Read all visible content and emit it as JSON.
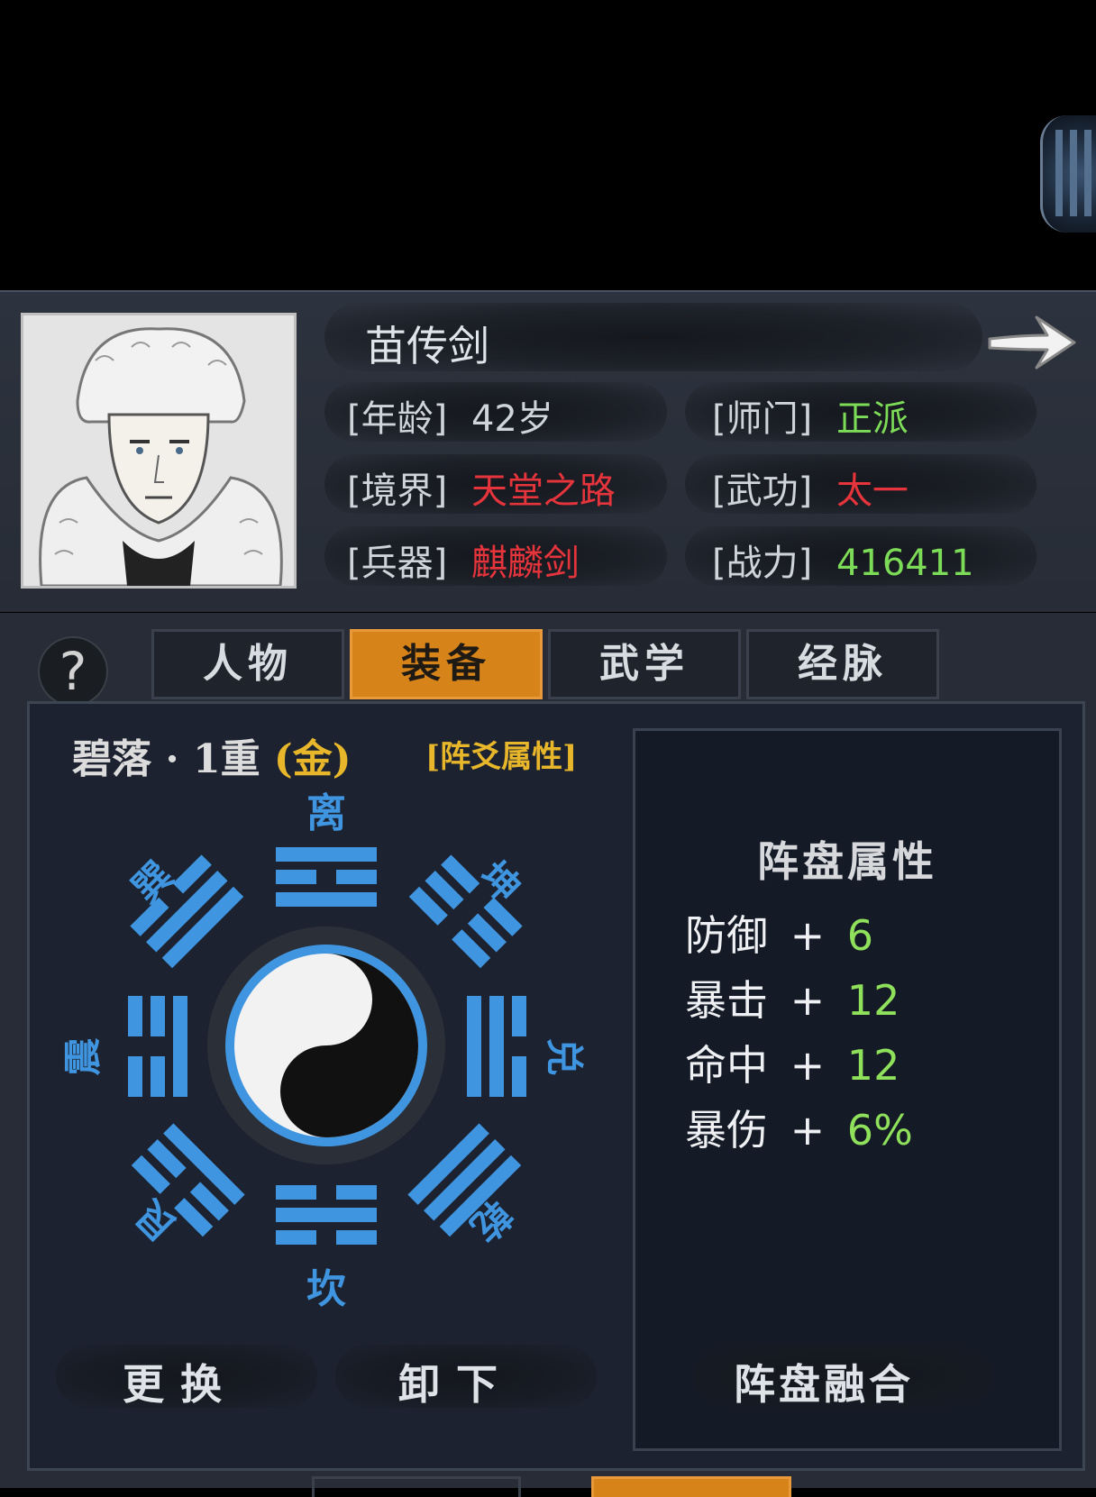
{
  "character": {
    "name": "苗传剑",
    "age_label": "[年龄]",
    "age_value": "42岁",
    "sect_label": "[师门]",
    "sect_value": "正派",
    "realm_label": "[境界]",
    "realm_value": "天堂之路",
    "skill_label": "[武功]",
    "skill_value": "太一",
    "weapon_label": "[兵器]",
    "weapon_value": "麒麟剑",
    "power_label": "[战力]",
    "power_value": "416411"
  },
  "help_icon": "?",
  "tabs": [
    {
      "label": "人物",
      "active": false
    },
    {
      "label": "装备",
      "active": true
    },
    {
      "label": "武学",
      "active": false
    },
    {
      "label": "经脉",
      "active": false
    }
  ],
  "formation": {
    "name": "碧落 · 1重",
    "element_open": "(",
    "element": "金",
    "element_close": ")",
    "attr_link": "[阵爻属性]",
    "trigrams": {
      "li": "离",
      "kun": "坤",
      "dui": "兑",
      "qian": "乾",
      "kan": "坎",
      "gen": "艮",
      "zhen": "震",
      "xun": "巽"
    },
    "colors": {
      "trigram": "#3f95e0",
      "panel": "#1c2230"
    }
  },
  "stats": {
    "title": "阵盘属性",
    "rows": [
      {
        "name": "防御",
        "plus": "+",
        "value": "6"
      },
      {
        "name": "暴击",
        "plus": "+",
        "value": "12"
      },
      {
        "name": "命中",
        "plus": "+",
        "value": "12"
      },
      {
        "name": "暴伤",
        "plus": "+",
        "value": "6%"
      }
    ]
  },
  "buttons": {
    "replace": "更换",
    "unequip": "卸下",
    "fuse": "阵盘融合"
  }
}
